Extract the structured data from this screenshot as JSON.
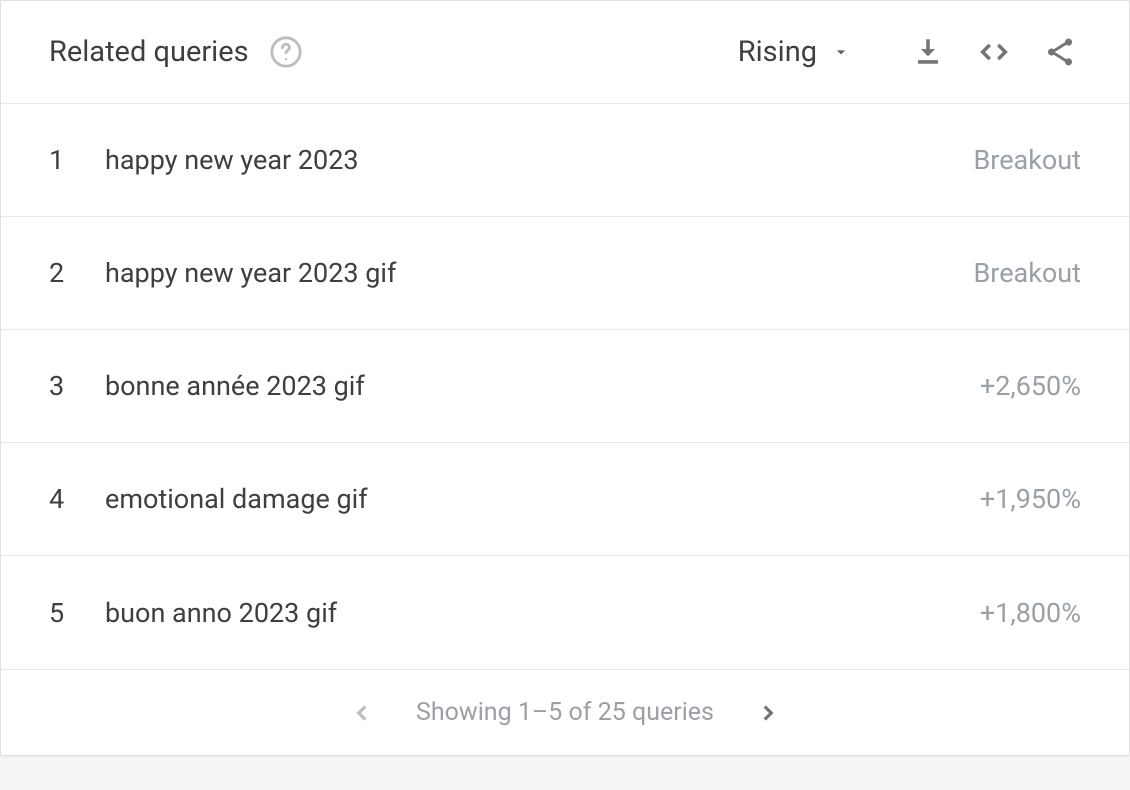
{
  "header": {
    "title": "Related queries",
    "sort_label": "Rising"
  },
  "rows": [
    {
      "rank": "1",
      "query": "happy new year 2023",
      "value": "Breakout"
    },
    {
      "rank": "2",
      "query": "happy new year 2023 gif",
      "value": "Breakout"
    },
    {
      "rank": "3",
      "query": "bonne année 2023 gif",
      "value": "+2,650%"
    },
    {
      "rank": "4",
      "query": "emotional damage gif",
      "value": "+1,950%"
    },
    {
      "rank": "5",
      "query": "buon anno 2023 gif",
      "value": "+1,800%"
    }
  ],
  "footer": {
    "showing_text": "Showing 1–5 of 25 queries"
  },
  "colors": {
    "text_primary": "#3c4043",
    "text_muted": "#9aa0a6",
    "border": "#e8e8e8",
    "icon_gray": "#757575"
  }
}
